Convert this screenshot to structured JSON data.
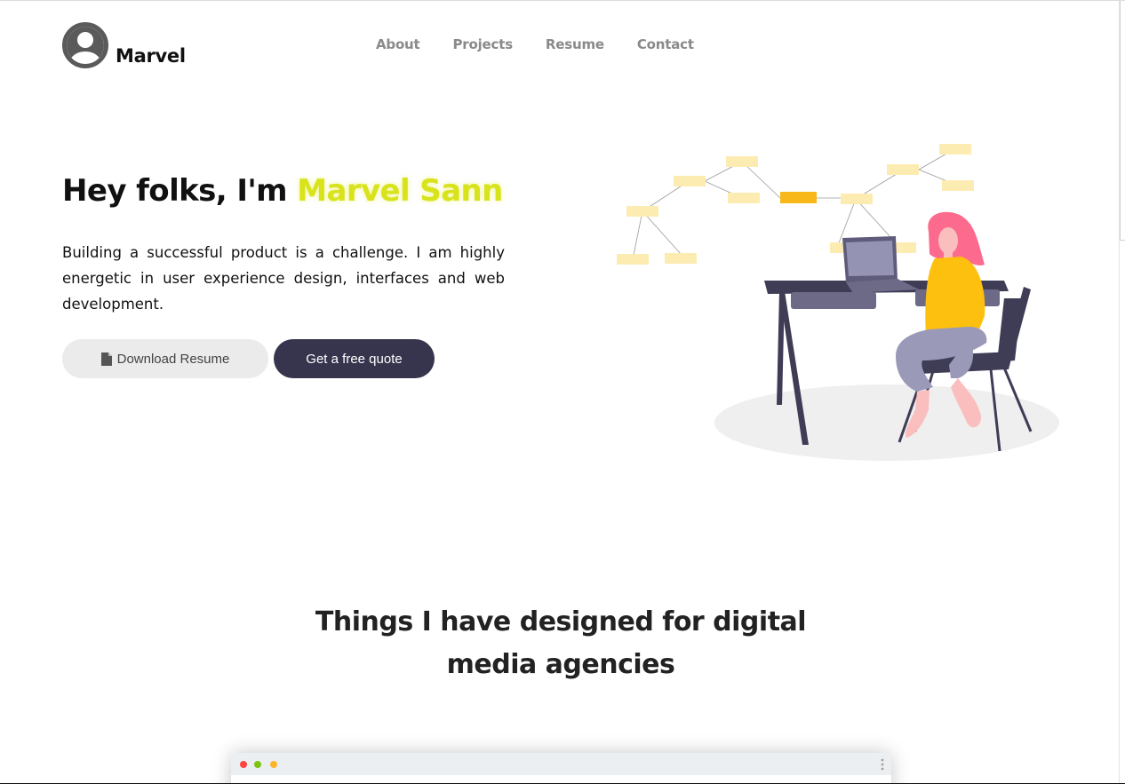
{
  "header": {
    "brand": "Marvel",
    "logo_icon": "user-avatar-icon",
    "nav": [
      {
        "label": "About"
      },
      {
        "label": "Projects"
      },
      {
        "label": "Resume"
      },
      {
        "label": "Contact"
      }
    ]
  },
  "hero": {
    "title_prefix": "Hey folks, I'm ",
    "title_name": "Marvel Sann",
    "description": "Building a successful product is a challenge. I am highly energetic in user experience design, interfaces and web development.",
    "download_label": "Download Resume",
    "download_icon": "document-icon",
    "quote_label": "Get a free quote"
  },
  "section": {
    "title": "Things I have designed for digital media agencies"
  },
  "colors": {
    "accent_name": "#d8e31c",
    "dark_button": "#37354d",
    "light_button": "#ebebeb",
    "nav_text": "#8a8a8a"
  }
}
